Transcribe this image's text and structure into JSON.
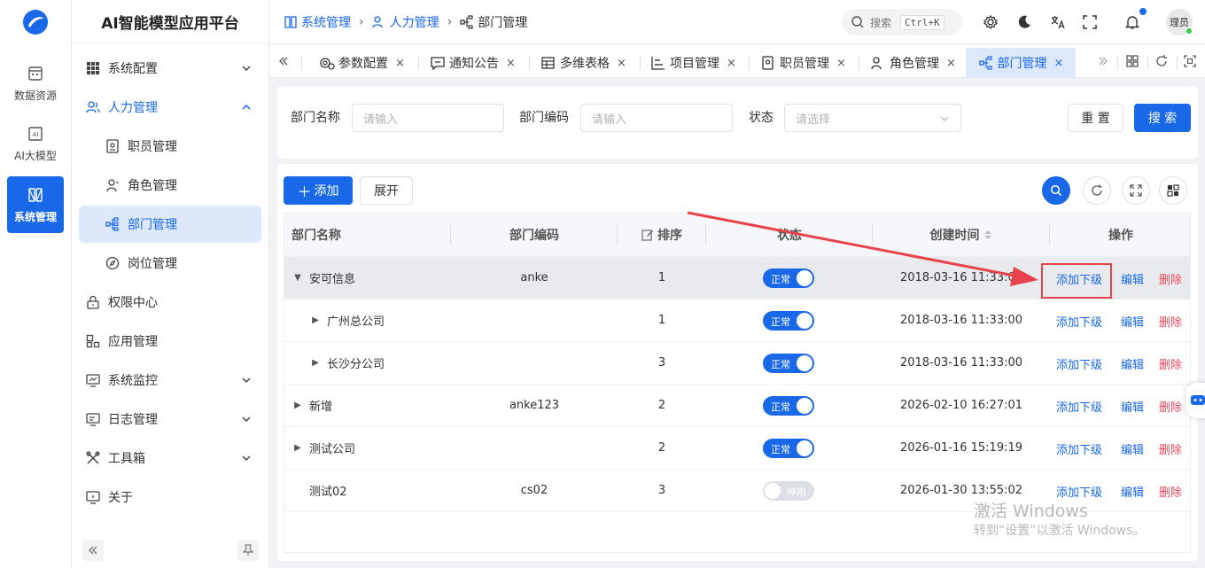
{
  "rail": {
    "items": [
      {
        "label": "数据资源"
      },
      {
        "label": "AI大模型"
      },
      {
        "label": "系统管理"
      }
    ]
  },
  "menu": {
    "brand": "AI智能模型应用平台",
    "items": [
      {
        "label": "系统配置"
      },
      {
        "label": "人力管理"
      },
      {
        "label": "职员管理"
      },
      {
        "label": "角色管理"
      },
      {
        "label": "部门管理"
      },
      {
        "label": "岗位管理"
      },
      {
        "label": "权限中心"
      },
      {
        "label": "应用管理"
      },
      {
        "label": "系统监控"
      },
      {
        "label": "日志管理"
      },
      {
        "label": "工具箱"
      },
      {
        "label": "关于"
      }
    ]
  },
  "header": {
    "breadcrumb": [
      "系统管理",
      "人力管理",
      "部门管理"
    ],
    "search_label": "搜索",
    "shortcut": "Ctrl+K",
    "user": "理员"
  },
  "tabs": [
    {
      "label": "参数配置",
      "icon": "settings-gear-icon"
    },
    {
      "label": "通知公告",
      "icon": "message-icon"
    },
    {
      "label": "多维表格",
      "icon": "table-icon"
    },
    {
      "label": "项目管理",
      "icon": "gantt-icon"
    },
    {
      "label": "职员管理",
      "icon": "id-card-icon"
    },
    {
      "label": "角色管理",
      "icon": "user-icon"
    },
    {
      "label": "部门管理",
      "icon": "org-icon"
    }
  ],
  "tab_close": "×",
  "filter": {
    "name_label": "部门名称",
    "name_placeholder": "请输入",
    "code_label": "部门编码",
    "code_placeholder": "请输入",
    "status_label": "状态",
    "status_placeholder": "请选择",
    "reset_label": "重 置",
    "search_label": "搜 索"
  },
  "toolbar": {
    "add_label": "添加",
    "expand_label": "展开"
  },
  "table": {
    "columns": {
      "name": "部门名称",
      "code": "部门编码",
      "sort": "排序",
      "status": "状态",
      "created": "创建时间",
      "actions": "操作"
    },
    "rows": [
      {
        "caret": "▼",
        "name": "安可信息",
        "code": "anke",
        "sort": "1",
        "status": "正常",
        "created": "2018-03-16 11:33:00"
      },
      {
        "caret": "▶",
        "name": "广州总公司",
        "code": "",
        "sort": "1",
        "status": "正常",
        "created": "2018-03-16 11:33:00"
      },
      {
        "caret": "▶",
        "name": "长沙分公司",
        "code": "",
        "sort": "3",
        "status": "正常",
        "created": "2018-03-16 11:33:00"
      },
      {
        "caret": "▶",
        "name": "新增",
        "code": "anke123",
        "sort": "2",
        "status": "正常",
        "created": "2026-02-10 16:27:01"
      },
      {
        "caret": "▶",
        "name": "测试公司",
        "code": "",
        "sort": "2",
        "status": "正常",
        "created": "2026-01-16 15:19:19"
      },
      {
        "caret": "",
        "name": "测试02",
        "code": "cs02",
        "sort": "3",
        "status": "停用",
        "created": "2026-01-30 13:55:02"
      }
    ],
    "action_add_child": "添加下级",
    "action_edit": "编辑",
    "action_delete": "删除"
  },
  "watermark": {
    "line1": "激活 Windows",
    "line2": "转到“设置”以激活 Windows。"
  },
  "colors": {
    "primary": "#1868e8",
    "danger": "#f0475b",
    "annotation": "#e8424a"
  }
}
